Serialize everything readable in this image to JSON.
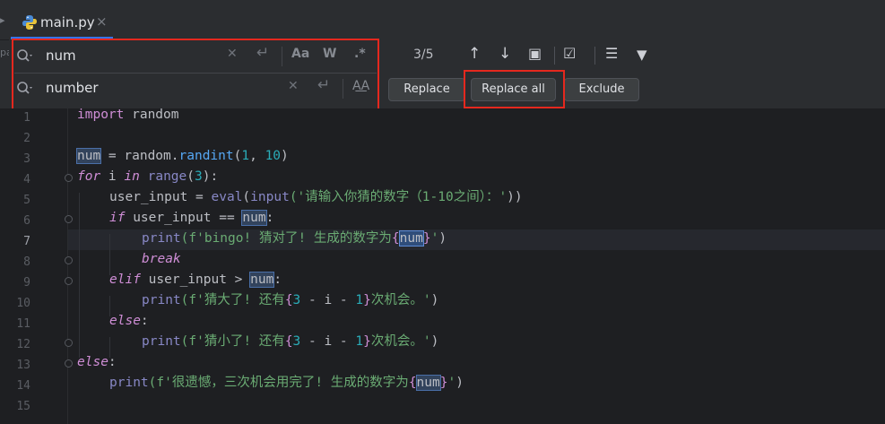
{
  "tab": {
    "filename": "main.py",
    "close_glyph": "×"
  },
  "side": {
    "text": "pa"
  },
  "find": {
    "value": "num",
    "icons": [
      "search-icon",
      "clear-icon",
      "newline-icon",
      "match-case-icon",
      "whole-words-icon",
      "regex-icon"
    ],
    "clear_glyph": "✕",
    "newline_glyph": "↵",
    "match_case_label": "Aa",
    "whole_words_label": "W",
    "regex_label": ".*"
  },
  "replace": {
    "value": "number",
    "clear_glyph": "✕",
    "newline_glyph": "↵",
    "preserve_case_label": "A͟A"
  },
  "toolbar": {
    "match_count": "3/5",
    "prev_glyph": "↑",
    "next_glyph": "↓",
    "select_all_glyph": "▣",
    "in_selection_glyph": "☑",
    "filter_glyph": "▼",
    "settings_glyph": "☰"
  },
  "buttons": {
    "replace": "Replace",
    "replace_all": "Replace all",
    "exclude": "Exclude"
  },
  "colors": {
    "accent": "#3574f0",
    "highlight_box": "#e5281e",
    "keyword": "#cf8ed6",
    "string": "#6aab73",
    "number": "#2aacb8",
    "function": "#56a8f5"
  },
  "editor": {
    "line_numbers": [
      "1",
      "2",
      "3",
      "4",
      "5",
      "6",
      "7",
      "8",
      "9",
      "10",
      "11",
      "12",
      "13",
      "14",
      "15"
    ],
    "current_line": 7,
    "code": {
      "l1_kw": "import",
      "l1_rest": " random",
      "l3_var": "num",
      "l3_mid": " = random.",
      "l3_fn": "randint",
      "l3_open": "(",
      "l3_a": "1",
      "l3_comma": ", ",
      "l3_b": "10",
      "l3_close": ")",
      "l4_for": "for",
      "l4_i": " i ",
      "l4_in": "in",
      "l4_sp": " ",
      "l4_range": "range",
      "l4_open": "(",
      "l4_n": "3",
      "l4_close": "):",
      "l5_pre": "user_input = ",
      "l5_eval": "eval",
      "l5_open": "(",
      "l5_input": "input",
      "l5_str": "('请输入你猜的数字（1-10之间）：'",
      "l5_close": "))",
      "l6_if": "if",
      "l6_mid": " user_input == ",
      "l6_var": "num",
      "l6_colon": ":",
      "l7_print": "print",
      "l7_str1": "(f'bingo! 猜对了! 生成的数字为",
      "l7_brace1": "{",
      "l7_var": "num",
      "l7_brace2": "}",
      "l7_str2": "'",
      "l7_close": ")",
      "l8_break": "break",
      "l9_elif": "elif",
      "l9_mid": " user_input > ",
      "l9_var": "num",
      "l9_colon": ":",
      "l10_print": "print",
      "l10_str1": "(f'猜大了! 还有",
      "l10_b1": "{",
      "l10_n3": "3",
      "l10_expr": " - i - ",
      "l10_n1": "1",
      "l10_b2": "}",
      "l10_str2": "次机会。'",
      "l10_close": ")",
      "l11_else": "else",
      "l11_colon": ":",
      "l12_print": "print",
      "l12_str1": "(f'猜小了! 还有",
      "l12_b1": "{",
      "l12_n3": "3",
      "l12_expr": " - i - ",
      "l12_n1": "1",
      "l12_b2": "}",
      "l12_str2": "次机会。'",
      "l12_close": ")",
      "l13_else": "else",
      "l13_colon": ":",
      "l14_print": "print",
      "l14_str1": "(f'很遗憾，三次机会用完了! 生成的数字为",
      "l14_b1": "{",
      "l14_var": "num",
      "l14_b2": "}",
      "l14_str2": "'",
      "l14_close": ")"
    }
  }
}
